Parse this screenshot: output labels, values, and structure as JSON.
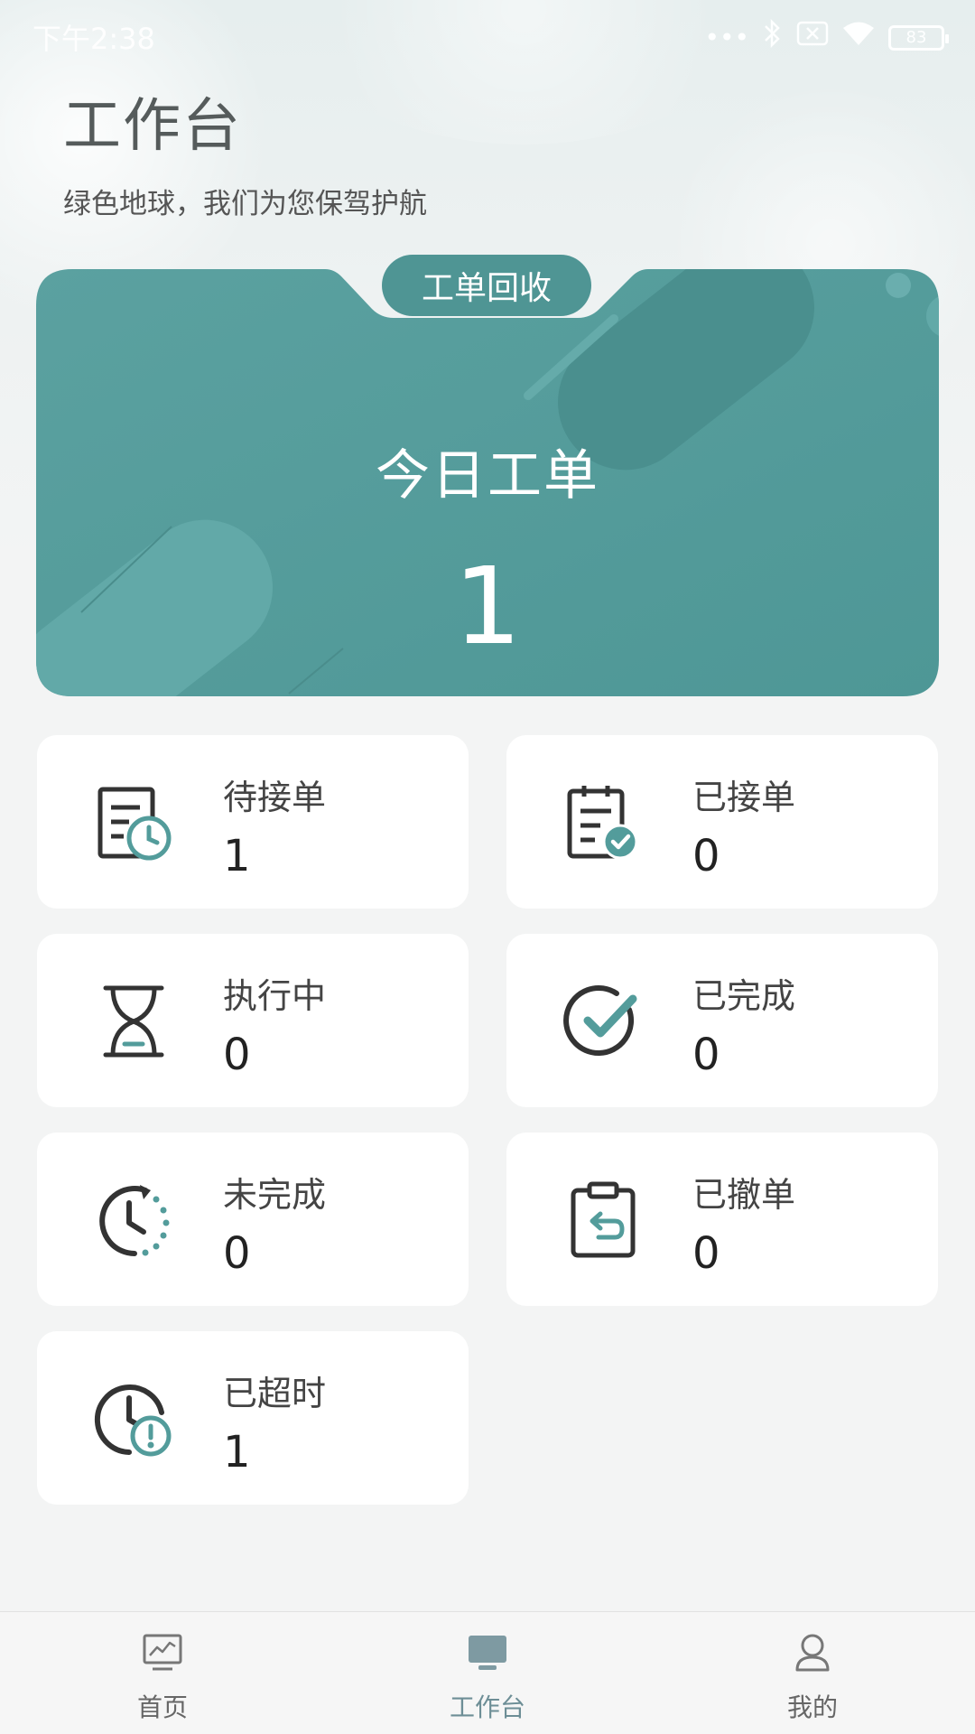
{
  "status_bar": {
    "time": "下午2:38",
    "battery": "83",
    "icons": [
      "signal-dots-icon",
      "bluetooth-icon",
      "sim-off-icon",
      "wifi-icon",
      "battery-icon"
    ]
  },
  "header": {
    "title": "工作台",
    "subtitle": "绿色地球，我们为您保驾护航"
  },
  "today_card": {
    "recycle_button": "工单回收",
    "label": "今日工单",
    "count": "1",
    "color": "#539c9b"
  },
  "stats": [
    {
      "label": "待接单",
      "value": "1",
      "icon": "pending-order-icon"
    },
    {
      "label": "已接单",
      "value": "0",
      "icon": "accepted-order-icon"
    },
    {
      "label": "执行中",
      "value": "0",
      "icon": "hourglass-icon"
    },
    {
      "label": "已完成",
      "value": "0",
      "icon": "check-circle-icon"
    },
    {
      "label": "未完成",
      "value": "0",
      "icon": "clock-refresh-icon"
    },
    {
      "label": "已撤单",
      "value": "0",
      "icon": "clipboard-return-icon"
    },
    {
      "label": "已超时",
      "value": "1",
      "icon": "clock-alert-icon"
    }
  ],
  "bottom_nav": {
    "items": [
      {
        "label": "首页",
        "icon": "dashboard-icon"
      },
      {
        "label": "工作台",
        "icon": "desktop-icon",
        "active": true
      },
      {
        "label": "我的",
        "icon": "user-icon"
      }
    ]
  },
  "colors": {
    "accent": "#539c9b",
    "icon_dark": "#333333",
    "nav_active": "#6d8e96"
  }
}
